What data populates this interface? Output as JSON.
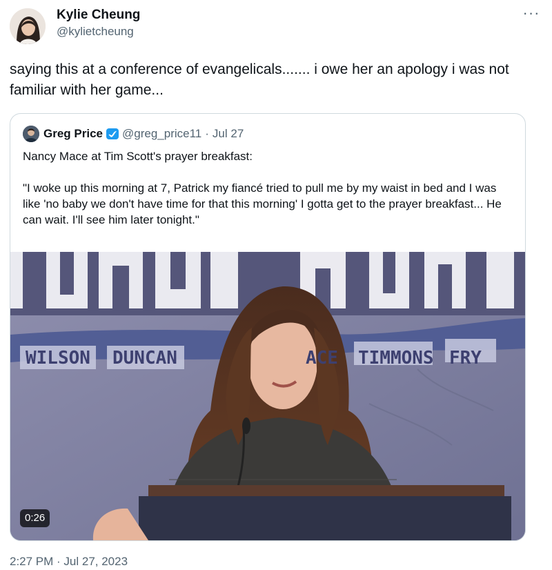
{
  "author": {
    "display_name": "Kylie Cheung",
    "handle": "@kylietcheung",
    "avatar_icon": "profile-photo"
  },
  "more_icon": "more-horizontal-icon",
  "tweet": {
    "text": "saying this at a conference of evangelicals....... i owe her an apology i was not familiar with her game..."
  },
  "quoted_tweet": {
    "display_name": "Greg Price",
    "verified": true,
    "verified_color": "#1d9bf0",
    "handle": "@greg_price11",
    "separator": "·",
    "date": "Jul 27",
    "text": "Nancy Mace at Tim Scott's prayer breakfast:\n\n\"I woke up this morning at 7, Patrick my fiancé tried to pull me by my waist in bed and I was like 'no baby we don't have time for that this morning' I gotta get to the prayer breakfast... He can wait. I'll see him later tonight.\"",
    "media": {
      "type": "video",
      "duration": "0:26",
      "banner_names": [
        "WILSON",
        "DUNCAN",
        "ACE",
        "TIMMONS",
        "FRY"
      ]
    }
  },
  "timestamp": "2:27 PM · Jul 27, 2023",
  "colors": {
    "text_primary": "#0f1419",
    "text_secondary": "#536471",
    "border": "#cfd9de"
  }
}
